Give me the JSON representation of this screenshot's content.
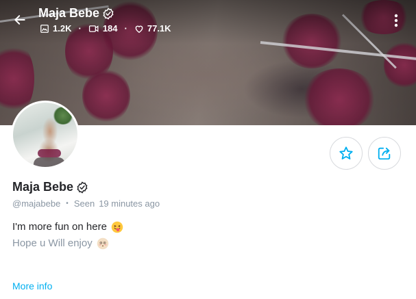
{
  "header": {
    "display_name": "Maja Bebe",
    "stats": {
      "photos": "1.2K",
      "videos": "184",
      "likes": "77.1K"
    }
  },
  "profile": {
    "display_name": "Maja Bebe",
    "handle": "@majabebe",
    "seen_label": "Seen",
    "seen_time": "19 minutes ago"
  },
  "bio": {
    "line1": "I'm more fun on here",
    "line2": "Hope u Will enjoy"
  },
  "more_info_label": "More info",
  "colors": {
    "accent": "#00aff0",
    "muted": "#8a96a3",
    "text": "#242529",
    "border": "#d7d9dd"
  },
  "icons": {
    "back": "arrow-left",
    "verified": "verified-badge",
    "photos": "image",
    "videos": "video",
    "likes": "heart",
    "menu": "vertical-dots",
    "favorite": "star-outline",
    "share": "share-box-arrow"
  }
}
